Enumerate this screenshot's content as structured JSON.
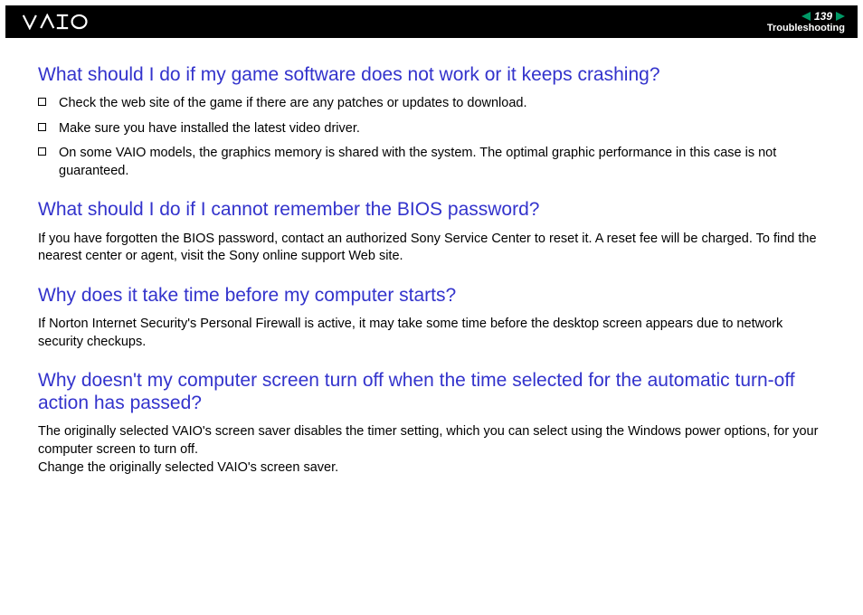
{
  "header": {
    "page_number": "139",
    "section": "Troubleshooting"
  },
  "sections": [
    {
      "question": "What should I do if my game software does not work or it keeps crashing?",
      "bullets": [
        "Check the web site of the game if there are any patches or updates to download.",
        "Make sure you have installed the latest video driver.",
        "On some VAIO models, the graphics memory is shared with the system. The optimal graphic performance in this case is not guaranteed."
      ]
    },
    {
      "question": "What should I do if I cannot remember the BIOS password?",
      "body": "If you have forgotten the BIOS password, contact an authorized Sony Service Center to reset it. A reset fee will be charged. To find the nearest center or agent, visit the Sony online support Web site."
    },
    {
      "question": "Why does it take time before my computer starts?",
      "body": "If Norton Internet Security's Personal Firewall is active, it may take some time before the desktop screen appears due to network security checkups."
    },
    {
      "question": "Why doesn't my computer screen turn off when the time selected for the automatic turn-off action has passed?",
      "body": "The originally selected VAIO's screen saver disables the timer setting, which you can select using the Windows power options, for your computer screen to turn off.\nChange the originally selected VAIO's screen saver."
    }
  ]
}
